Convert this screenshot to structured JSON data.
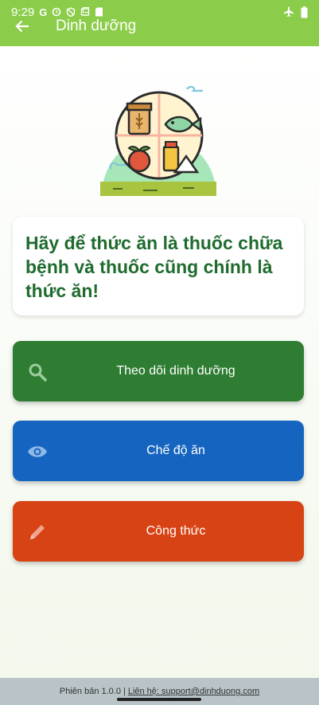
{
  "status_bar": {
    "time": "9:29",
    "left_icons": [
      "google-icon",
      "alarm-icon",
      "shield-icon",
      "screen-icon",
      "sd-card-icon"
    ],
    "right_icons": [
      "airplane-icon",
      "battery-icon"
    ]
  },
  "appbar": {
    "title": "Dinh dưỡng",
    "back_icon": "arrow-back-icon",
    "color": "#8bcd4a"
  },
  "hero": {
    "icon": "nutrition-plate-illustration"
  },
  "quote": {
    "text": "Hãy để thức ăn là thuốc chữa bệnh và thuốc cũng chính là thức ăn!"
  },
  "menu": [
    {
      "label": "Theo dõi dinh dưỡng",
      "icon": "search-icon",
      "color": "#2e7d32"
    },
    {
      "label": "Chế độ ăn",
      "icon": "eye-icon",
      "color": "#1565c0"
    },
    {
      "label": "Công thức",
      "icon": "pencil-icon",
      "color": "#d84315"
    }
  ],
  "footer": {
    "version": "Phiên bản 1.0.0",
    "separator": "|",
    "contact": "Liên hệ: support@dinhduong.com"
  }
}
